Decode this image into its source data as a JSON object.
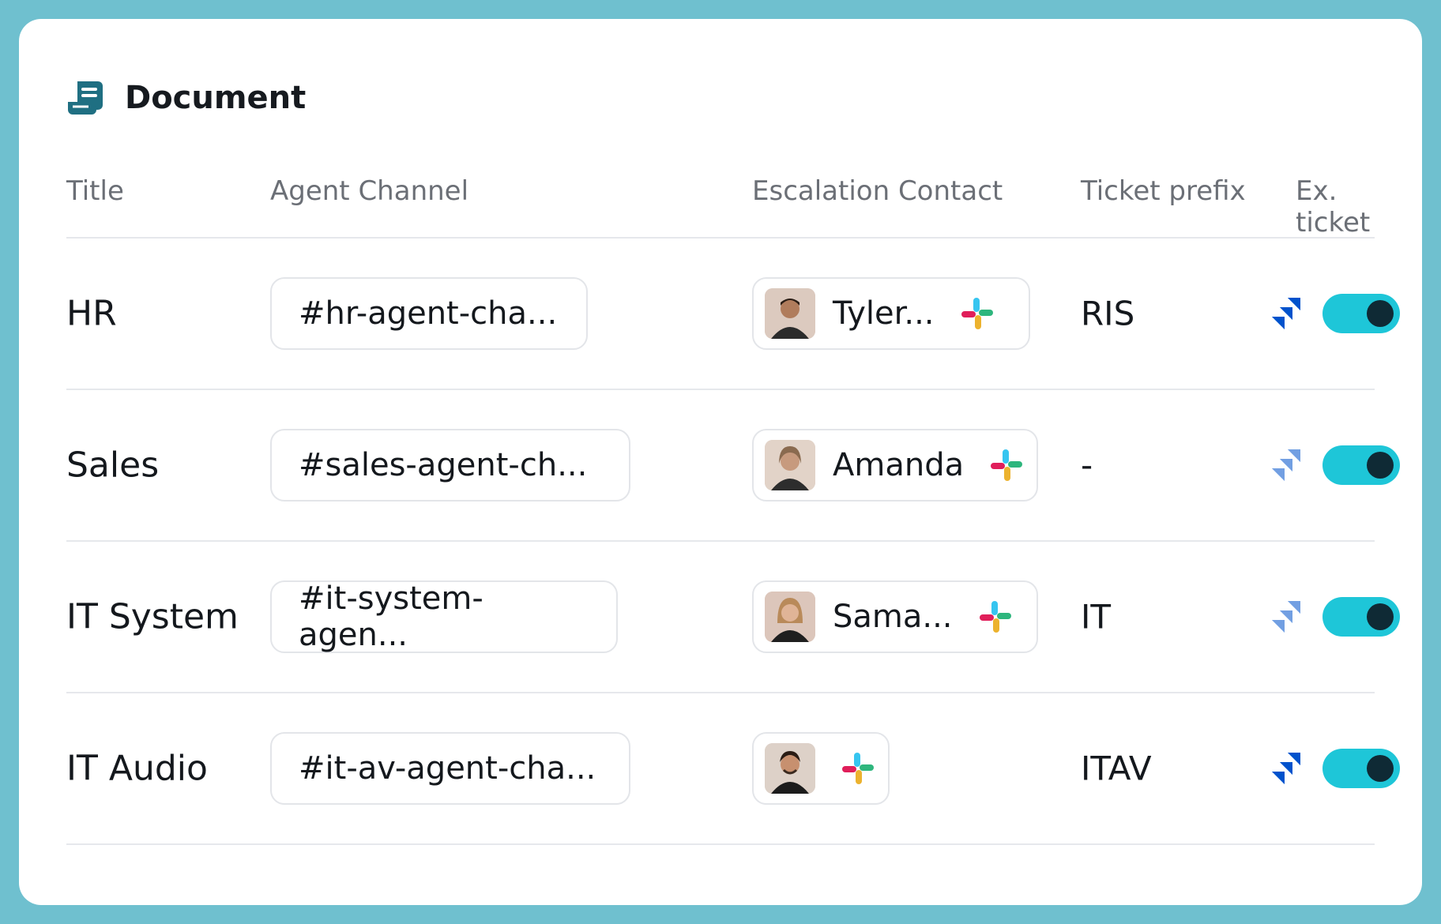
{
  "card": {
    "title": "Document",
    "title_icon": "document-icon"
  },
  "columns": {
    "title": "Title",
    "agent_channel": "Agent Channel",
    "escalation_contact": "Escalation Contact",
    "ticket_prefix": "Ticket prefix",
    "ex_ticket": "Ex. ticket"
  },
  "rows": [
    {
      "title": "HR",
      "channel": "#hr-agent-cha...",
      "contact_name": "Tyler...",
      "prefix": "RIS",
      "jira_icon": "jira-icon",
      "toggle_on": true
    },
    {
      "title": "Sales",
      "channel": "#sales-agent-ch...",
      "contact_name": "Amanda",
      "prefix": "-",
      "jira_icon": "jira-icon",
      "toggle_on": true
    },
    {
      "title": "IT System",
      "channel": "#it-system-agen...",
      "contact_name": "Sama...",
      "prefix": "IT",
      "jira_icon": "jira-icon",
      "toggle_on": true
    },
    {
      "title": "IT Audio",
      "channel": "#it-av-agent-cha...",
      "contact_name": "",
      "prefix": "ITAV",
      "jira_icon": "jira-icon",
      "toggle_on": true
    }
  ],
  "colors": {
    "frame": "#6fc0cf",
    "toggle_on": "#1ec6d8",
    "toggle_knob": "#0f2a35",
    "jira_blue": "#2684ff",
    "icon_teal": "#1f6f82"
  }
}
